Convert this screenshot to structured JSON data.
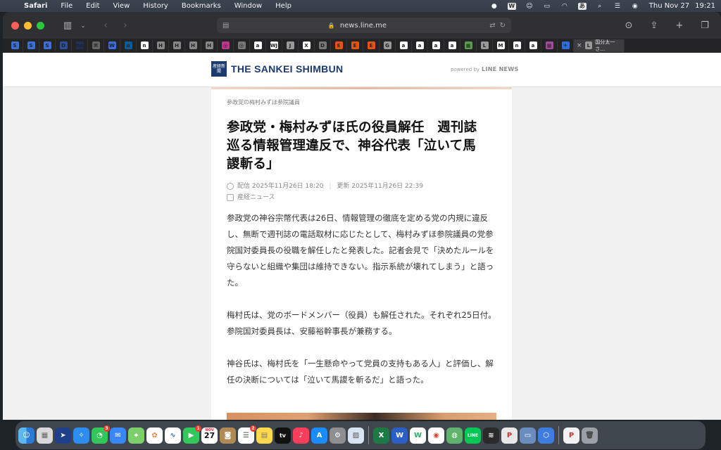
{
  "menubar": {
    "app_name": "Safari",
    "menus": [
      "File",
      "Edit",
      "View",
      "History",
      "Bookmarks",
      "Window",
      "Help"
    ],
    "status_icons": [
      "line-icon",
      "w-icon",
      "face-icon",
      "battery-icon",
      "wifi-icon",
      "input-icon",
      "search-icon",
      "control-center-icon",
      "siri-icon"
    ],
    "input_label": "あ",
    "date": "Thu Nov 27",
    "time": "19:21"
  },
  "toolbar": {
    "url": "news.line.me"
  },
  "tabs": {
    "favicons": [
      "S",
      "S",
      "S",
      "D",
      "mn",
      "⌘",
      "W",
      "o",
      "n",
      "H",
      "H",
      "H",
      "H",
      "◎",
      "◎",
      "a",
      "WJ",
      "J",
      "X",
      "D",
      "E",
      "E",
      "E",
      "G",
      "a",
      "a",
      "a",
      "a",
      "▦",
      "L",
      "M",
      "n",
      "a",
      "▦",
      "✈"
    ],
    "active_title": "国分太一さ…",
    "active_favicon": "L"
  },
  "site": {
    "logo_text": "THE SANKEI SHIMBUN",
    "logo_mark": "産経新聞",
    "powered_by": "powered by",
    "powered_brand": "LINE NEWS"
  },
  "article": {
    "category": "参政党の梅村みずほ参院議員",
    "headline_lines": [
      "参政党・梅村みずほ氏の役員解任　週刊誌",
      "巡る情報管理違反で、神谷代表「泣いて馬",
      "謖斬る」"
    ],
    "published": "配信 2025年11月26日 18:20",
    "updated": "更新 2025年11月26日 22:39",
    "source": "産経ニュース",
    "paragraphs": [
      "参政党の神谷宗幣代表は26日、情報管理の徹底を定める党の内規に違反し、無断で週刊誌の電話取材に応じたとして、梅村みずほ参院議員の党参院国対委員長の役職を解任したと発表した。記者会見で「決めたルールを守らないと組織や集団は維持できない。指示系統が壊れてしまう」と語った。",
      "梅村氏は、党のボードメンバー（役員）も解任された。それぞれ25日付。参院国対委員長は、安藤裕幹事長が兼務する。",
      "神谷氏は、梅村氏を「一生懸命やって党員の支持もある人」と評価し、解任の決断については「泣いて馬謖を斬るだ」と語った。"
    ]
  },
  "dock": {
    "calendar_month": "NOV",
    "calendar_day": "27",
    "messages_badge": "3",
    "facetime_badge": "1",
    "reminders_badge": "2",
    "appletv_label": "tv",
    "appstore_label": "A",
    "excel_label": "X",
    "word_label": "W",
    "writer_label": "W",
    "line_label": "LINE"
  }
}
